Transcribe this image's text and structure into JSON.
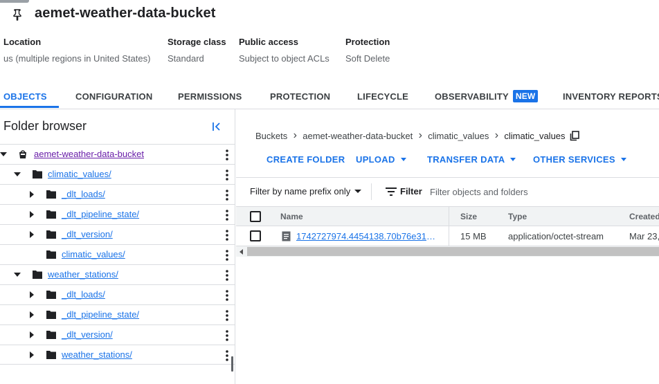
{
  "header": {
    "bucket_name": "aemet-weather-data-bucket",
    "pin_icon": "pin-icon"
  },
  "meta": {
    "location_label": "Location",
    "location_value": "us (multiple regions in United States)",
    "storage_class_label": "Storage class",
    "storage_class_value": "Standard",
    "public_access_label": "Public access",
    "public_access_value": "Subject to object ACLs",
    "protection_label": "Protection",
    "protection_value": "Soft Delete"
  },
  "tabs": [
    {
      "label": "OBJECTS",
      "active": true
    },
    {
      "label": "CONFIGURATION"
    },
    {
      "label": "PERMISSIONS"
    },
    {
      "label": "PROTECTION"
    },
    {
      "label": "LIFECYCLE"
    },
    {
      "label": "OBSERVABILITY",
      "badge": "NEW"
    },
    {
      "label": "INVENTORY REPORTS"
    }
  ],
  "folder_browser": {
    "title": "Folder browser",
    "items": [
      {
        "label": "aemet-weather-data-bucket",
        "type": "bucket",
        "expanded": true
      },
      {
        "label": "climatic_values/",
        "type": "folder",
        "expanded": true
      },
      {
        "label": "_dlt_loads/",
        "type": "folder",
        "expanded": false
      },
      {
        "label": "_dlt_pipeline_state/",
        "type": "folder",
        "expanded": false
      },
      {
        "label": "_dlt_version/",
        "type": "folder",
        "expanded": false
      },
      {
        "label": "climatic_values/",
        "type": "folder"
      },
      {
        "label": "weather_stations/",
        "type": "folder",
        "expanded": true
      },
      {
        "label": "_dlt_loads/",
        "type": "folder",
        "expanded": false
      },
      {
        "label": "_dlt_pipeline_state/",
        "type": "folder",
        "expanded": false
      },
      {
        "label": "_dlt_version/",
        "type": "folder",
        "expanded": false
      },
      {
        "label": "weather_stations/",
        "type": "folder",
        "expanded": false
      }
    ]
  },
  "breadcrumb": [
    "Buckets",
    "aemet-weather-data-bucket",
    "climatic_values",
    "climatic_values"
  ],
  "actions": {
    "create_folder": "CREATE FOLDER",
    "upload": "UPLOAD",
    "transfer_data": "TRANSFER DATA",
    "other_services": "OTHER SERVICES"
  },
  "filter": {
    "prefix_option": "Filter by name prefix only",
    "label": "Filter",
    "placeholder": "Filter objects and folders"
  },
  "table": {
    "columns": [
      "Name",
      "Size",
      "Type",
      "Created"
    ],
    "rows": [
      {
        "name": "1742727974.4454138.70b76e310…",
        "size": "15 MB",
        "type": "application/octet-stream",
        "created": "Mar 23,"
      }
    ]
  },
  "colors": {
    "accent": "#1a73e8",
    "visited": "#681da8",
    "border": "#dadce0"
  }
}
